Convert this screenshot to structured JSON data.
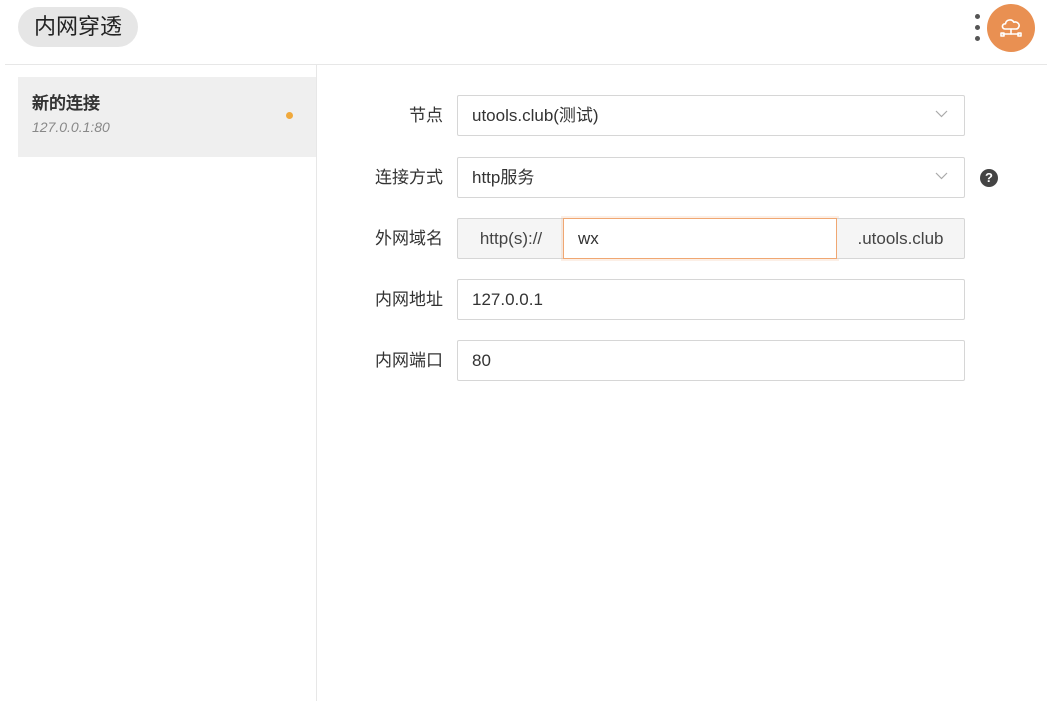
{
  "header": {
    "title": "内网穿透",
    "more_icon": "more-vertical-icon",
    "avatar_icon": "cloud-network-icon",
    "accent": "#e99052"
  },
  "sidebar": {
    "items": [
      {
        "name": "新的连接",
        "address": "127.0.0.1:80",
        "status_color": "#f0a93c",
        "selected": true
      }
    ]
  },
  "form": {
    "node": {
      "label": "节点",
      "value": "utools.club(测试)"
    },
    "method": {
      "label": "连接方式",
      "value": "http服务",
      "help": "?"
    },
    "domain": {
      "label": "外网域名",
      "prefix": "http(s)://",
      "value": "wx",
      "suffix": ".utools.club"
    },
    "local_address": {
      "label": "内网地址",
      "value": "127.0.0.1"
    },
    "local_port": {
      "label": "内网端口",
      "value": "80"
    }
  }
}
